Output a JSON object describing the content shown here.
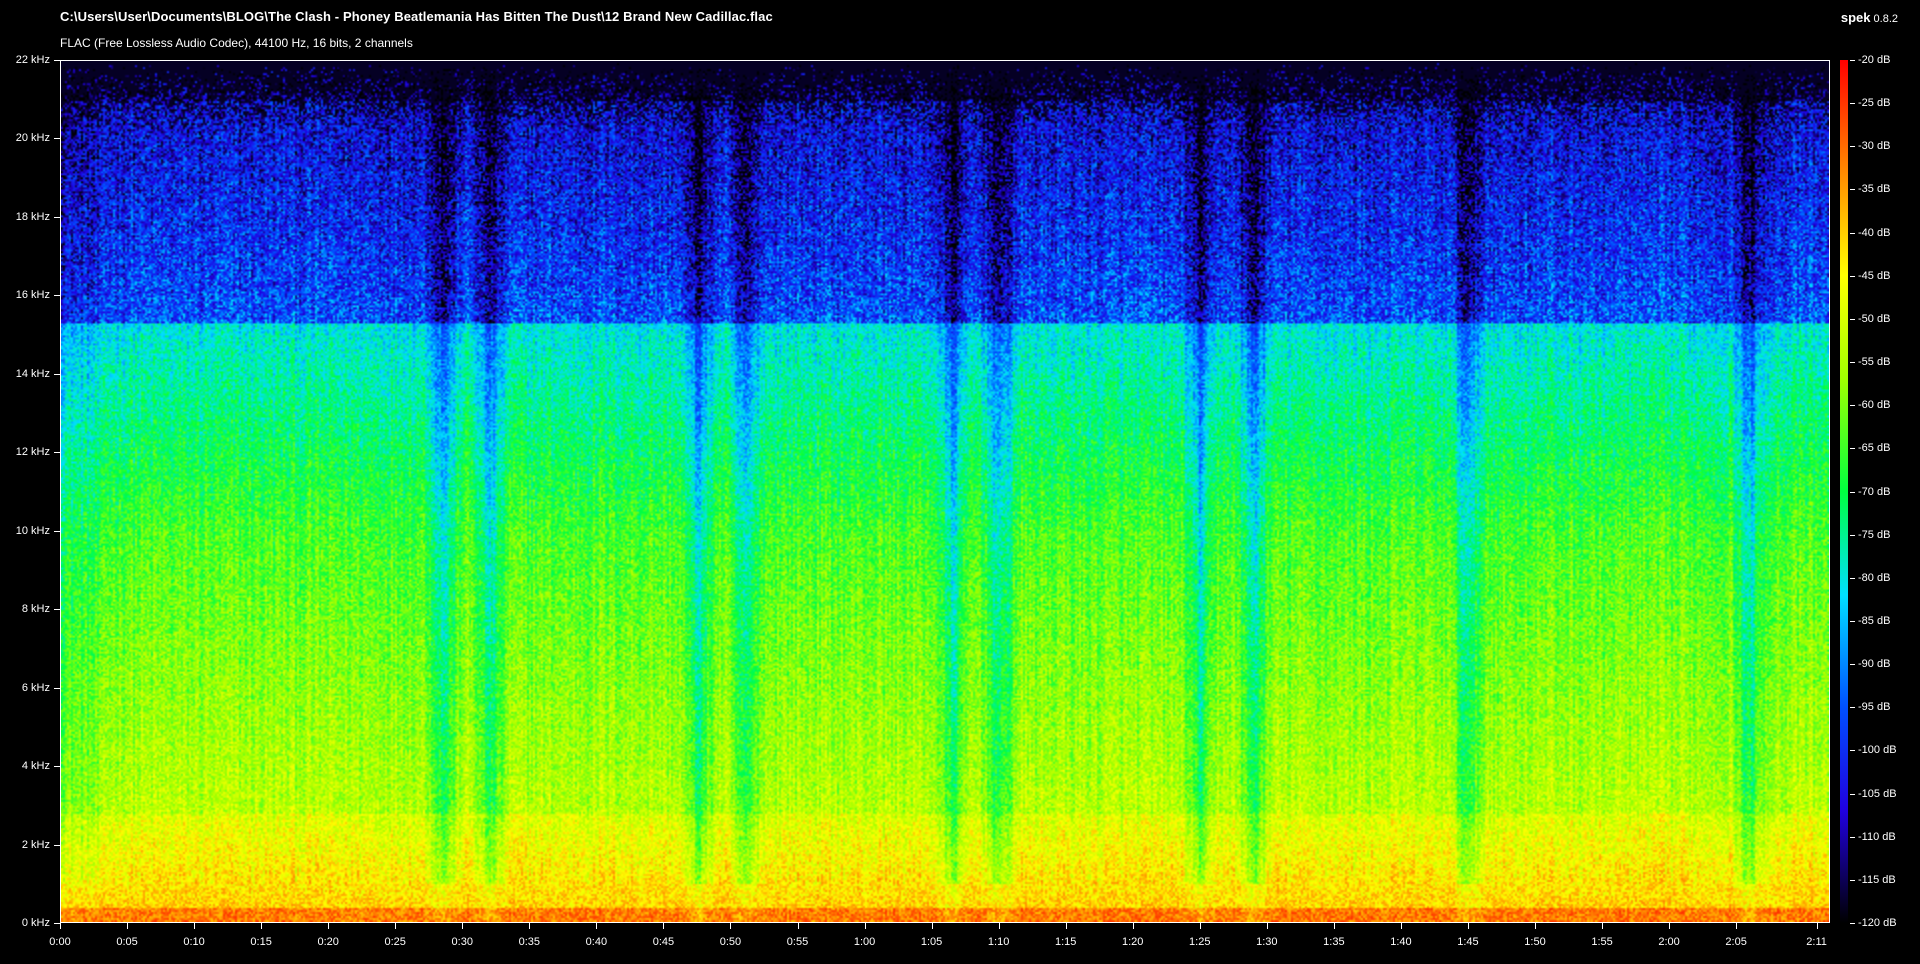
{
  "header": {
    "file_path": "C:\\Users\\User\\Documents\\BLOG\\The Clash - Phoney Beatlemania Has Bitten The Dust\\12 Brand New Cadillac.flac",
    "file_info": "FLAC (Free Lossless Audio Codec), 44100 Hz, 16 bits, 2 channels",
    "app_name": "spek",
    "app_version": "0.8.2"
  },
  "colors": {
    "background": "#000000",
    "text": "#ffffff",
    "frame": "#ffffff"
  },
  "chart_data": {
    "type": "heatmap",
    "y_axis": {
      "unit": "kHz",
      "range": [
        0,
        22
      ],
      "ticks": [
        "0 kHz",
        "2 kHz",
        "4 kHz",
        "6 kHz",
        "8 kHz",
        "10 kHz",
        "12 kHz",
        "14 kHz",
        "16 kHz",
        "18 kHz",
        "20 kHz",
        "22 kHz"
      ],
      "tick_values": [
        0,
        2,
        4,
        6,
        8,
        10,
        12,
        14,
        16,
        18,
        20,
        22
      ]
    },
    "x_axis": {
      "unit": "seconds",
      "range": [
        0,
        132
      ],
      "ticks": [
        "0:00",
        "0:05",
        "0:10",
        "0:15",
        "0:20",
        "0:25",
        "0:30",
        "0:35",
        "0:40",
        "0:45",
        "0:50",
        "0:55",
        "1:00",
        "1:05",
        "1:10",
        "1:15",
        "1:20",
        "1:25",
        "1:30",
        "1:35",
        "1:40",
        "1:45",
        "1:50",
        "1:55",
        "2:00",
        "2:05",
        "2:11"
      ],
      "tick_values": [
        0,
        5,
        10,
        15,
        20,
        25,
        30,
        35,
        40,
        45,
        50,
        55,
        60,
        65,
        70,
        75,
        80,
        85,
        90,
        95,
        100,
        105,
        110,
        115,
        120,
        125,
        131
      ]
    },
    "color_scale": {
      "unit": "dB",
      "range": [
        -120,
        -20
      ],
      "ticks": [
        "-20 dB",
        "-25 dB",
        "-30 dB",
        "-35 dB",
        "-40 dB",
        "-45 dB",
        "-50 dB",
        "-55 dB",
        "-60 dB",
        "-65 dB",
        "-70 dB",
        "-75 dB",
        "-80 dB",
        "-85 dB",
        "-90 dB",
        "-95 dB",
        "-100 dB",
        "-105 dB",
        "-110 dB",
        "-115 dB",
        "-120 dB"
      ],
      "tick_values": [
        -20,
        -25,
        -30,
        -35,
        -40,
        -45,
        -50,
        -55,
        -60,
        -65,
        -70,
        -75,
        -80,
        -85,
        -90,
        -95,
        -100,
        -105,
        -110,
        -115,
        -120
      ],
      "colormap": [
        "#000000",
        "#2000e0",
        "#0050ff",
        "#00e0ff",
        "#00ff40",
        "#a0ff00",
        "#ffff00",
        "#ff8000",
        "#ff0000"
      ]
    },
    "lowpass_cutoff_khz": 15.3,
    "quiet_sections_seconds": [
      28.5,
      32,
      47.5,
      51,
      66.5,
      70,
      85,
      89,
      105,
      126
    ]
  }
}
